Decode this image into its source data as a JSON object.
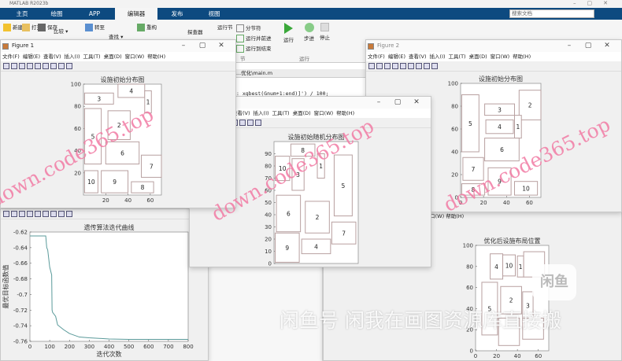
{
  "app": {
    "title": "MATLAB R2023b",
    "window_controls": [
      "–",
      "▢",
      "✕"
    ]
  },
  "tabs": [
    {
      "label": "主页"
    },
    {
      "label": "绘图"
    },
    {
      "label": "APP"
    },
    {
      "label": "编辑器",
      "active": true
    },
    {
      "label": "发布"
    },
    {
      "label": "视图"
    }
  ],
  "search": {
    "placeholder": "搜索文档"
  },
  "ribbon": {
    "new": "新建",
    "open": "打开",
    "save": "保存",
    "compare": "比较 ▾",
    "goto": "转至",
    "find": "查找 ▾",
    "refactor": "重构",
    "profiler": "探查器",
    "run_section": "运行节",
    "section_break": "分节符",
    "run_advance": "运行并前进",
    "run_to_end": "运行到结束",
    "section_group": "节",
    "run": "运行",
    "step": "步进",
    "stop": "停止",
    "run_group": "运行"
  },
  "editor": {
    "tab": "...优化\\main.m",
    "code": ": xgbest(Gnum+1:end)]') / 100;"
  },
  "figure_menu": [
    "文件(F)",
    "编辑(E)",
    "查看(V)",
    "插入(I)",
    "工具(T)",
    "桌面(D)",
    "窗口(W)",
    "帮助(H)"
  ],
  "windows": {
    "fig1": {
      "title": "Figure 1"
    },
    "fig2": {
      "title": "Figure 2"
    },
    "fig3": {
      "title": ""
    },
    "fig4": {
      "menu_partial": "图(D)  窗口(W)  帮助(H)"
    }
  },
  "chart_data": [
    {
      "id": "fig1",
      "type": "rect-layout",
      "title": "设施初始分布图",
      "xlim": [
        0,
        70
      ],
      "ylim": [
        0,
        100
      ],
      "xticks": [
        20,
        40,
        60
      ],
      "yticks": [
        20,
        40,
        60,
        80,
        100
      ],
      "rects": [
        {
          "label": "3",
          "x": 1,
          "y": 82,
          "w": 26,
          "h": 10
        },
        {
          "label": "4",
          "x": 31,
          "y": 88,
          "w": 24,
          "h": 12
        },
        {
          "label": "1",
          "x": 55,
          "y": 74,
          "w": 6,
          "h": 20
        },
        {
          "label": "5",
          "x": 1,
          "y": 28,
          "w": 15,
          "h": 50
        },
        {
          "label": "2",
          "x": 22,
          "y": 50,
          "w": 20,
          "h": 26
        },
        {
          "label": "6",
          "x": 20,
          "y": 28,
          "w": 30,
          "h": 20
        },
        {
          "label": "7",
          "x": 52,
          "y": 16,
          "w": 18,
          "h": 20
        },
        {
          "label": "10",
          "x": 1,
          "y": 2,
          "w": 12,
          "h": 20
        },
        {
          "label": "9",
          "x": 16,
          "y": 2,
          "w": 24,
          "h": 20
        },
        {
          "label": "8",
          "x": 43,
          "y": 2,
          "w": 20,
          "h": 10
        }
      ]
    },
    {
      "id": "fig2",
      "type": "rect-layout",
      "title": "设施初始分布图",
      "xlim": [
        0,
        70
      ],
      "ylim": [
        0,
        100
      ],
      "xticks": [
        0,
        20,
        40,
        60
      ],
      "yticks": [
        0,
        20,
        40,
        60,
        80,
        100
      ],
      "rects": [
        {
          "label": "5",
          "x": 1,
          "y": 40,
          "w": 15,
          "h": 50
        },
        {
          "label": "3",
          "x": 21,
          "y": 72,
          "w": 26,
          "h": 10
        },
        {
          "label": "2",
          "x": 51,
          "y": 68,
          "w": 19,
          "h": 26
        },
        {
          "label": "4",
          "x": 22,
          "y": 56,
          "w": 24,
          "h": 12
        },
        {
          "label": "1",
          "x": 47,
          "y": 52,
          "w": 6,
          "h": 20
        },
        {
          "label": "6",
          "x": 21,
          "y": 32,
          "w": 30,
          "h": 20
        },
        {
          "label": "7",
          "x": 2,
          "y": 15,
          "w": 18,
          "h": 20
        },
        {
          "label": "8",
          "x": 1,
          "y": 2,
          "w": 20,
          "h": 10
        },
        {
          "label": "9",
          "x": 24,
          "y": 2,
          "w": 20,
          "h": 24
        },
        {
          "label": "10",
          "x": 47,
          "y": 2,
          "w": 20,
          "h": 12
        }
      ]
    },
    {
      "id": "fig3",
      "type": "rect-layout",
      "title": "设施初始随机分布图",
      "xlim": [
        0,
        70
      ],
      "ylim": [
        0,
        100
      ],
      "xticks": [],
      "yticks": [
        0,
        10,
        20,
        30,
        40,
        50,
        60,
        70,
        80,
        90
      ],
      "rects": [
        {
          "label": "8",
          "x": 14,
          "y": 88,
          "w": 20,
          "h": 10
        },
        {
          "label": "10",
          "x": 1,
          "y": 68,
          "w": 12,
          "h": 20
        },
        {
          "label": "3",
          "x": 15,
          "y": 60,
          "w": 10,
          "h": 26
        },
        {
          "label": "1",
          "x": 36,
          "y": 70,
          "w": 6,
          "h": 20
        },
        {
          "label": "5",
          "x": 50,
          "y": 39,
          "w": 15,
          "h": 50
        },
        {
          "label": "6",
          "x": 2,
          "y": 26,
          "w": 20,
          "h": 30
        },
        {
          "label": "2",
          "x": 26,
          "y": 25,
          "w": 20,
          "h": 26
        },
        {
          "label": "7",
          "x": 48,
          "y": 16,
          "w": 20,
          "h": 18
        },
        {
          "label": "9",
          "x": 1,
          "y": 1,
          "w": 20,
          "h": 24
        },
        {
          "label": "4",
          "x": 23,
          "y": 8,
          "w": 24,
          "h": 12
        }
      ]
    },
    {
      "id": "fig4",
      "type": "rect-layout",
      "title": "优化后设施布局位置",
      "xlim": [
        0,
        70
      ],
      "ylim": [
        0,
        100
      ],
      "xticks": [
        0,
        20,
        40,
        60
      ],
      "yticks": [
        0,
        20,
        40,
        60,
        80,
        100
      ],
      "rects": [
        {
          "label": "4",
          "x": 14,
          "y": 68,
          "w": 12,
          "h": 24
        },
        {
          "label": "10",
          "x": 26,
          "y": 71,
          "w": 12,
          "h": 20
        },
        {
          "label": "1",
          "x": 40,
          "y": 70,
          "w": 6,
          "h": 20
        },
        {
          "label": "",
          "x": 46,
          "y": 70,
          "w": 20,
          "h": 24
        },
        {
          "label": "5",
          "x": 6,
          "y": 15,
          "w": 15,
          "h": 50
        },
        {
          "label": "2",
          "x": 24,
          "y": 35,
          "w": 20,
          "h": 26
        },
        {
          "label": "3",
          "x": 45,
          "y": 30,
          "w": 10,
          "h": 26
        },
        {
          "label": "",
          "x": 22,
          "y": 5,
          "w": 20,
          "h": 26
        },
        {
          "label": "",
          "x": 45,
          "y": 11,
          "w": 20,
          "h": 20
        }
      ]
    },
    {
      "id": "conv",
      "type": "line",
      "title": "遗传算法迭代曲线",
      "xlabel": "迭代次数",
      "ylabel": "最优目标函数值",
      "xlim": [
        0,
        800
      ],
      "ylim": [
        -0.76,
        -0.62
      ],
      "xticks": [
        0,
        100,
        200,
        300,
        400,
        500,
        600,
        700,
        800
      ],
      "yticks": [
        -0.62,
        -0.64,
        -0.66,
        -0.68,
        -0.7,
        -0.72,
        -0.74,
        -0.76
      ],
      "x": [
        0,
        80,
        85,
        90,
        100,
        110,
        112,
        115,
        130,
        140,
        170,
        200,
        250,
        300,
        350,
        400,
        500,
        800
      ],
      "y": [
        -0.625,
        -0.625,
        -0.64,
        -0.643,
        -0.665,
        -0.675,
        -0.72,
        -0.723,
        -0.728,
        -0.739,
        -0.745,
        -0.75,
        -0.7545,
        -0.7555,
        -0.7562,
        -0.757,
        -0.7575,
        -0.7575
      ],
      "color": "#5a9a9a"
    }
  ],
  "watermarks": {
    "url": "down.code365.top",
    "xianyu": "闲鱼号 闲我在画图资源库直接搬",
    "logo": "闲鱼"
  },
  "colors": {
    "tabbar": "#0d4a80",
    "rect_stroke": "#b8a0a0",
    "watermark": "#f27ba4"
  }
}
